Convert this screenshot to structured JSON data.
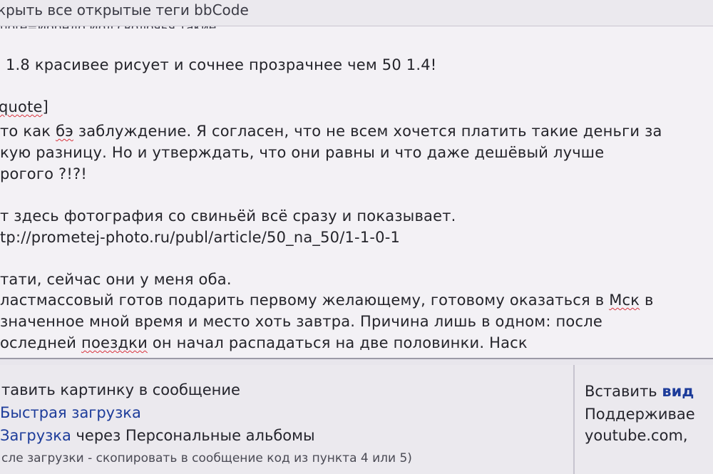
{
  "header": {
    "close_tags_label": "крыть все открытые теги bbCode"
  },
  "editor": {
    "cutoff_line": "uote=Иорндо Иол сволочья такие.",
    "lines": [
      "1.8 красивее рисует и сочнее прозрачнее чем 50 1.4!",
      "quote]",
      "то как бэ заблуждение. Я согласен, что не всем хочется платить такие деньги за",
      "кую разницу. Но и утверждать, что они равны и что даже дешёвый лучше",
      "рогого ?!?!",
      "т здесь фотография со свиньёй всё сразу и показывает.",
      "tp://prometej-photo.ru/publ/article/50_na_50/1-1-0-1",
      "тати, сейчас они у меня оба.",
      "ластмассовый готов подарить первому желающему, готовому оказаться в Мск в",
      "значенное мной время и место хоть завтра. Причина лишь в одном: после",
      "оследней поездки он начал распадаться на две половинки. Наск"
    ]
  },
  "image_panel": {
    "title": "тавить картинку в сообщение",
    "quick_upload": "Быстрая загрузка",
    "upload_link": "Загрузка",
    "upload_suffix": " через Персональные альбомы",
    "note": "сле загрузки - скопировать в сообщение код из пункта 4 или 5)"
  },
  "video_panel": {
    "title_prefix": "Вставить ",
    "title_link": "вид",
    "supported": "Поддерживае",
    "sites": "youtube.com,"
  }
}
